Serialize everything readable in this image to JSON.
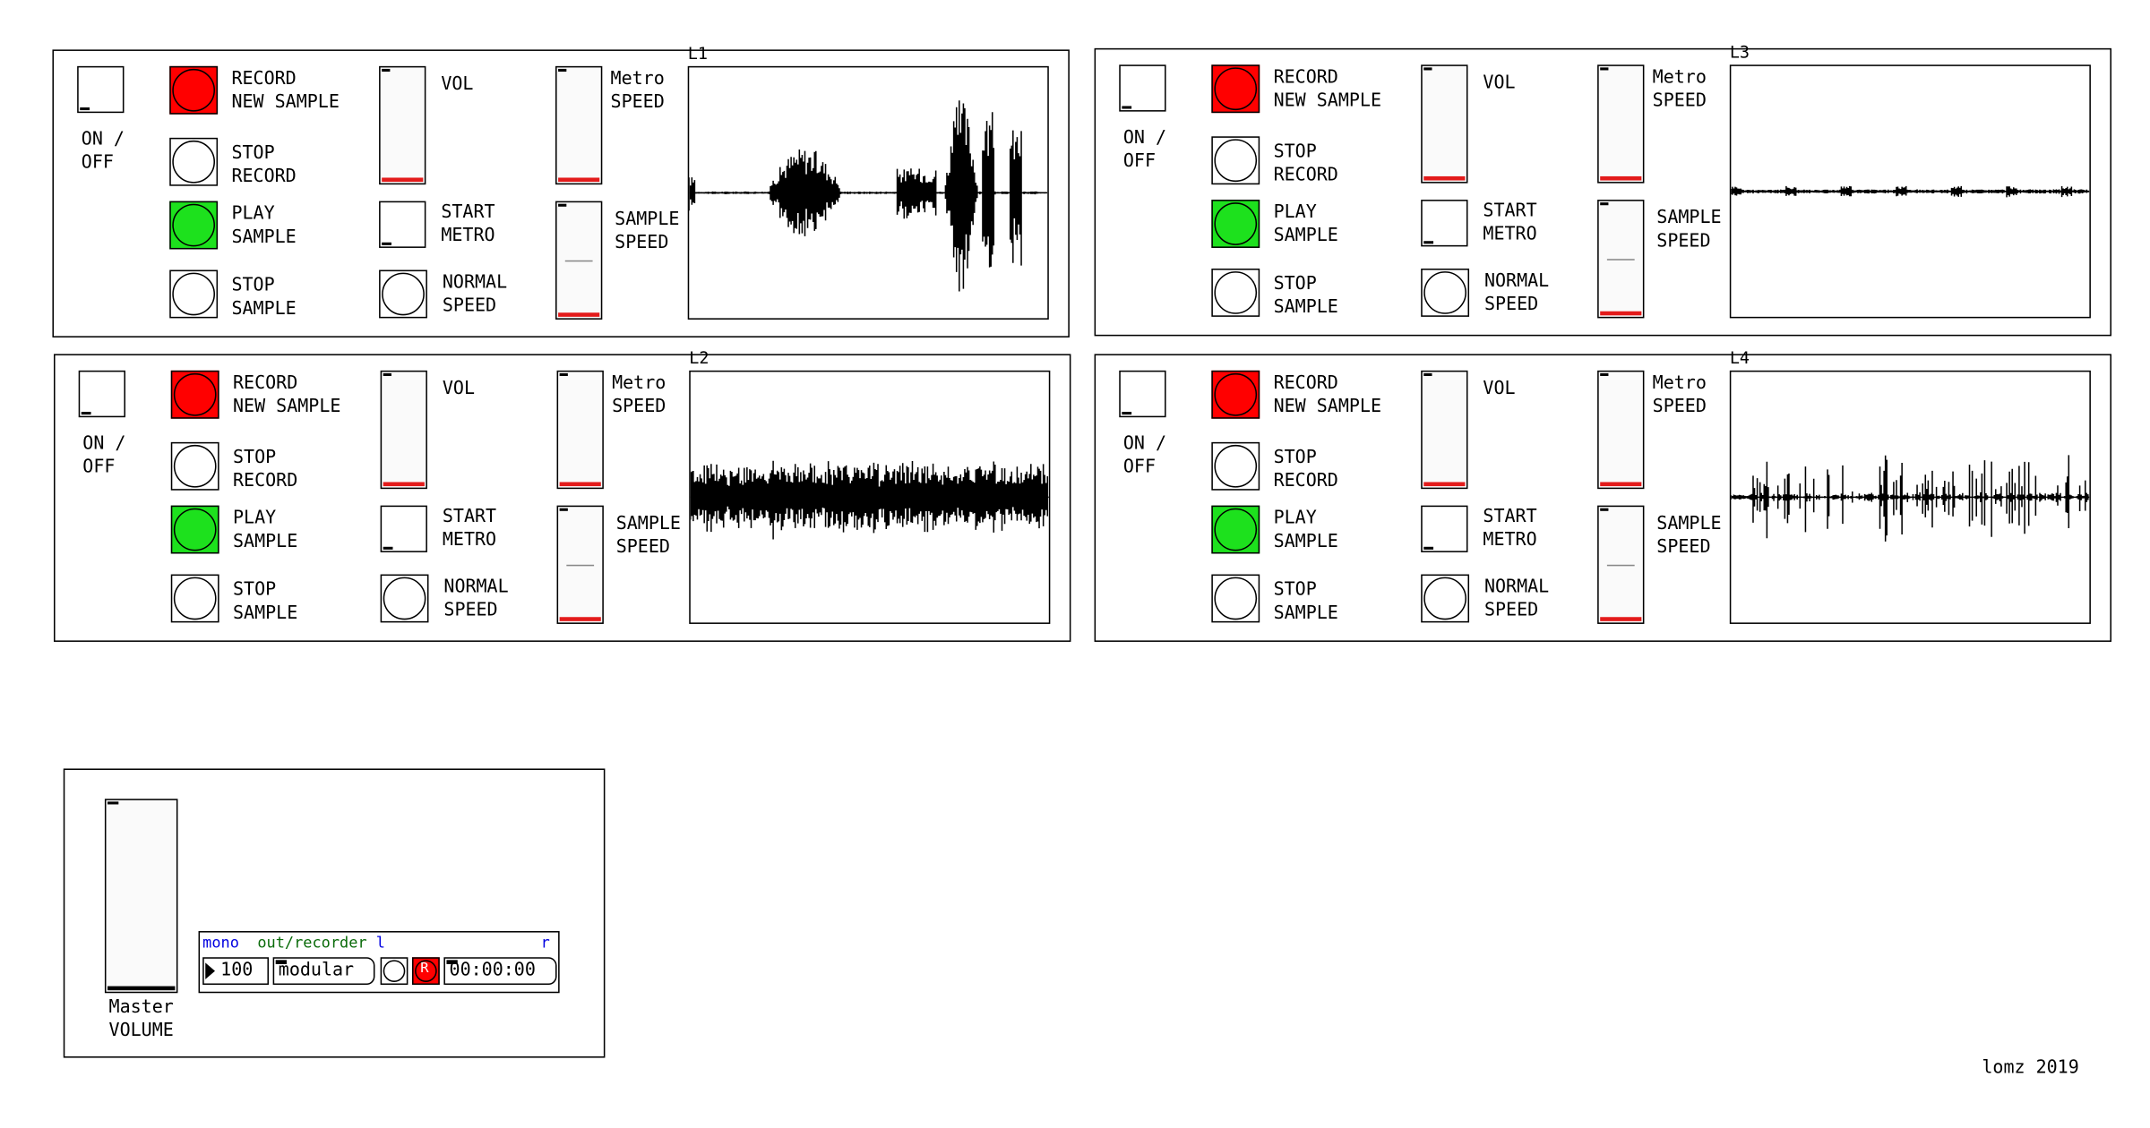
{
  "loopers": [
    {
      "id": "L1",
      "title": "L1",
      "wave": "speech"
    },
    {
      "id": "L3",
      "title": "L3",
      "wave": "flat"
    },
    {
      "id": "L2",
      "title": "L2",
      "wave": "noise"
    },
    {
      "id": "L4",
      "title": "L4",
      "wave": "sparse"
    }
  ],
  "labels": {
    "on_off": "ON /\nOFF",
    "record": "RECORD\nNEW SAMPLE",
    "stop_record": "STOP\nRECORD",
    "play": "PLAY\nSAMPLE",
    "stop_sample": "STOP\nSAMPLE",
    "vol": "VOL",
    "start_metro": "START\nMETRO",
    "normal_speed": "NORMAL\nSPEED",
    "metro_speed": "Metro\nSPEED",
    "sample_speed": "SAMPLE\nSPEED"
  },
  "master": {
    "label": "Master\nVOLUME",
    "recorder": {
      "mono": "mono",
      "name": "out/recorder",
      "l": "l",
      "r": "r",
      "channels": "100",
      "mode": "modular",
      "time": "00:00:00",
      "rec_glyph": "R"
    }
  },
  "credit": "lomz 2019",
  "colors": {
    "record": "#ff0000",
    "play": "#1de11d",
    "slider_knob": "#e31b1b"
  }
}
